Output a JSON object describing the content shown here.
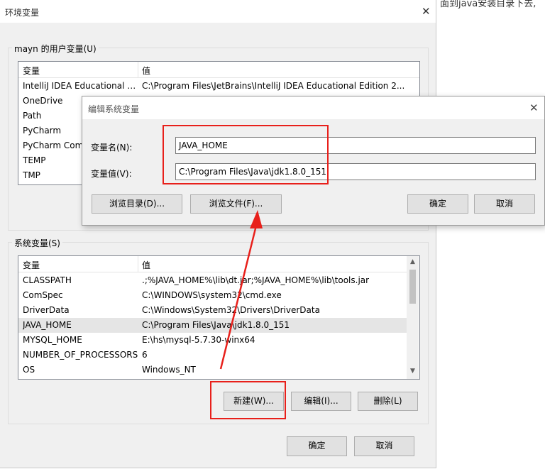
{
  "background_page": {
    "left_text": "",
    "right_text": "面到java安装目录下去,"
  },
  "env_window": {
    "title": "环境变量",
    "close_glyph": "✕",
    "user_group": {
      "label": "mayn 的用户变量(U)",
      "columns": [
        "变量",
        "值"
      ],
      "rows": [
        {
          "name": "IntelliJ IDEA Educational E...",
          "value": "C:\\Program Files\\JetBrains\\IntelliJ IDEA Educational Edition 2..."
        },
        {
          "name": "OneDrive",
          "value": ""
        },
        {
          "name": "Path",
          "value": ""
        },
        {
          "name": "PyCharm",
          "value": ""
        },
        {
          "name": "PyCharm Comm",
          "value": ""
        },
        {
          "name": "TEMP",
          "value": ""
        },
        {
          "name": "TMP",
          "value": ""
        }
      ]
    },
    "system_group": {
      "label": "系统变量(S)",
      "columns": [
        "变量",
        "值"
      ],
      "rows": [
        {
          "name": "CLASSPATH",
          "value": ".;%JAVA_HOME%\\lib\\dt.jar;%JAVA_HOME%\\lib\\tools.jar"
        },
        {
          "name": "ComSpec",
          "value": "C:\\WINDOWS\\system32\\cmd.exe"
        },
        {
          "name": "DriverData",
          "value": "C:\\Windows\\System32\\Drivers\\DriverData"
        },
        {
          "name": "JAVA_HOME",
          "value": "C:\\Program Files\\Java\\jdk1.8.0_151"
        },
        {
          "name": "MYSQL_HOME",
          "value": "E:\\hs\\mysql-5.7.30-winx64"
        },
        {
          "name": "NUMBER_OF_PROCESSORS",
          "value": "6"
        },
        {
          "name": "OS",
          "value": "Windows_NT"
        }
      ],
      "selected_index": 3,
      "buttons": {
        "new": "新建(W)...",
        "edit": "编辑(I)...",
        "delete": "删除(L)"
      }
    },
    "footer_buttons": {
      "ok": "确定",
      "cancel": "取消"
    }
  },
  "edit_dialog": {
    "title": "编辑系统变量",
    "close_glyph": "✕",
    "name_label": "变量名(N):",
    "name_value": "JAVA_HOME",
    "value_label": "变量值(V):",
    "value_value": "C:\\Program Files\\Java\\jdk1.8.0_151",
    "buttons": {
      "browse_dir": "浏览目录(D)...",
      "browse_file": "浏览文件(F)...",
      "ok": "确定",
      "cancel": "取消"
    }
  },
  "annotation_color": "#e8201b",
  "scroll_up_glyph": "▲",
  "scroll_down_glyph": "▼"
}
